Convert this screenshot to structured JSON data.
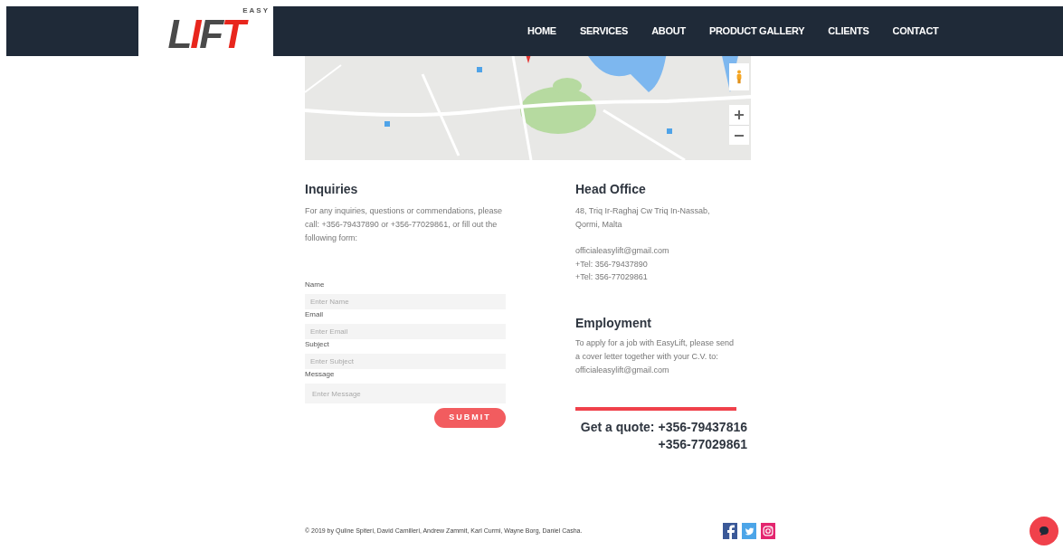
{
  "logo": {
    "small": "E A S Y",
    "main": "LIFT"
  },
  "nav": [
    {
      "label": "HOME"
    },
    {
      "label": "SERVICES"
    },
    {
      "label": "ABOUT"
    },
    {
      "label": "PRODUCT GALLERY"
    },
    {
      "label": "CLIENTS"
    },
    {
      "label": "CONTACT"
    }
  ],
  "inquiries": {
    "title": "Inquiries",
    "text": "For any inquiries, questions or commendations, please call: +356-79437890 or +356-77029861, or fill out the following form:",
    "fields": [
      {
        "label": "Name",
        "placeholder": "Enter Name",
        "kind": "input"
      },
      {
        "label": "Email",
        "placeholder": "Enter Email",
        "kind": "input"
      },
      {
        "label": "Subject",
        "placeholder": "Enter Subject",
        "kind": "input"
      },
      {
        "label": "Message",
        "placeholder": "Enter Message",
        "kind": "textarea"
      }
    ],
    "submit": "SUBMIT"
  },
  "head_office": {
    "title": "Head Office",
    "address": "48, Triq Ir-Raghaj Cw Triq In-Nassab, Qormi, Malta",
    "contacts": [
      "officialeasylift@gmail.com",
      "+Tel: 356-79437890",
      "+Tel: 356-77029861"
    ]
  },
  "employment": {
    "title": "Employment",
    "text": "To apply for a job with EasyLift, please send a cover letter together with your C.V. to: officialeasylift@gmail.com"
  },
  "quote": {
    "label": "Get a quote:",
    "phones": [
      "+356-79437816",
      "+356-77029861"
    ]
  },
  "footer": {
    "copyright": "© 2019 by Quline Spiteri, David Camilleri, Andrew Zammit, Karl Curmi, Wayne Borg, Daniel Casha.",
    "social": [
      {
        "kind": "facebook",
        "color": "#3b5998"
      },
      {
        "kind": "twitter",
        "color": "#4ca5e8"
      },
      {
        "kind": "instagram",
        "color": "#e4266f"
      }
    ]
  }
}
